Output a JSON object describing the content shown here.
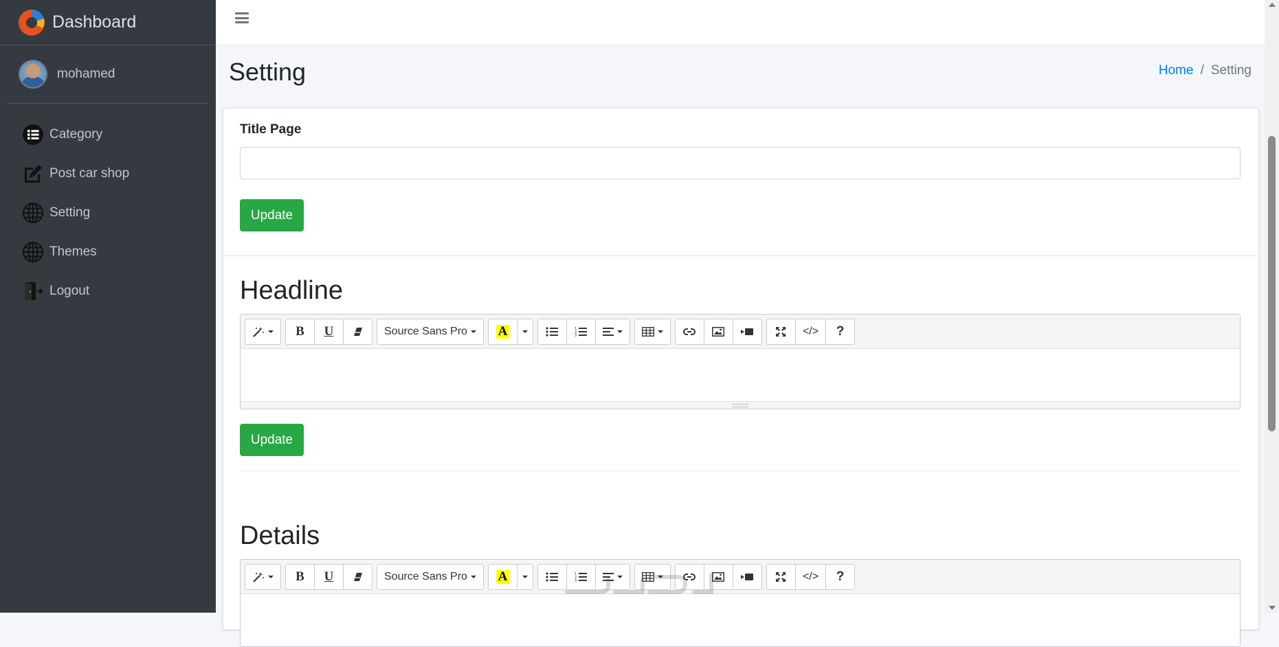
{
  "brand": {
    "title": "Dashboard"
  },
  "user": {
    "name": "mohamed"
  },
  "sidebar": {
    "items": [
      {
        "label": "Category",
        "icon": "list-icon"
      },
      {
        "label": "Post car shop",
        "icon": "edit-icon"
      },
      {
        "label": "Setting",
        "icon": "globe-icon"
      },
      {
        "label": "Themes",
        "icon": "globe-icon"
      },
      {
        "label": "Logout",
        "icon": "logout-icon"
      }
    ]
  },
  "page": {
    "title": "Setting"
  },
  "breadcrumb": {
    "home": "Home",
    "separator": "/",
    "current": "Setting"
  },
  "form": {
    "title_label": "Title Page",
    "title_value": "",
    "update_label": "Update",
    "headline_title": "Headline",
    "details_title": "Details"
  },
  "editor": {
    "font_name": "Source Sans Pro",
    "bold": "B",
    "underline": "U",
    "color_letter": "A",
    "code": "</>",
    "help": "?"
  },
  "colors": {
    "sidebar_bg": "#343a40",
    "primary": "#007bff",
    "success": "#28a745",
    "content_bg": "#f4f6f9"
  }
}
